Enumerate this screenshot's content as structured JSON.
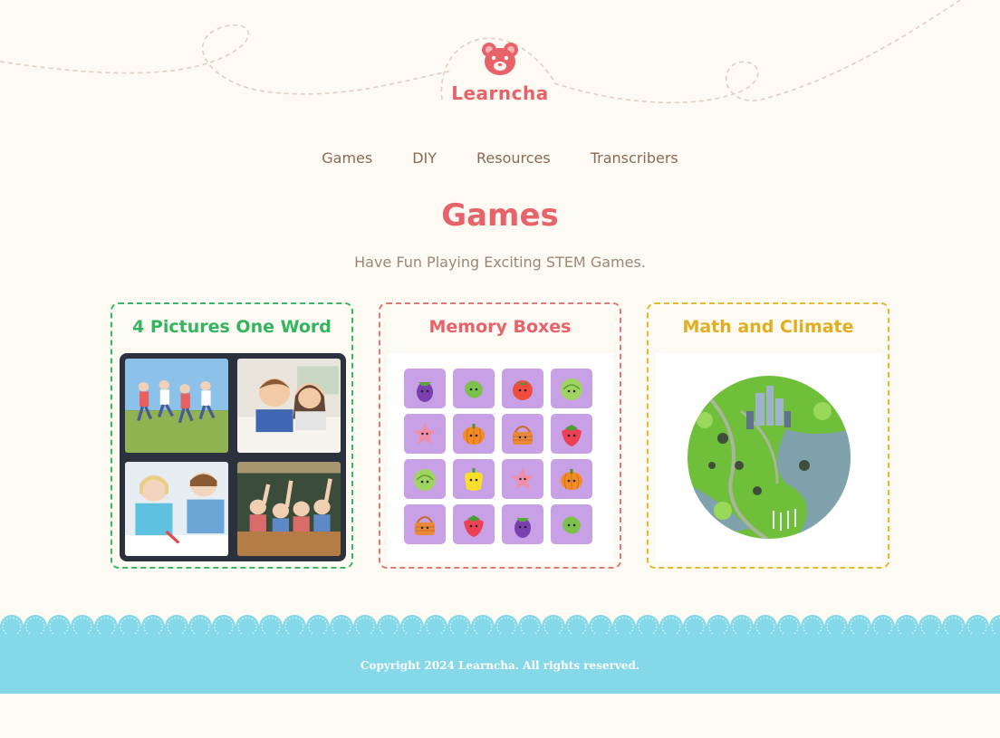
{
  "brand": {
    "name": "Learncha"
  },
  "nav": {
    "items": [
      {
        "label": "Games"
      },
      {
        "label": "DIY"
      },
      {
        "label": "Resources"
      },
      {
        "label": "Transcribers"
      }
    ]
  },
  "page": {
    "title": "Games",
    "subtitle": "Have Fun Playing Exciting STEM Games."
  },
  "cards": [
    {
      "title": "4 Pictures One Word",
      "accent": "#37b866"
    },
    {
      "title": "Memory Boxes",
      "accent": "#e37777"
    },
    {
      "title": "Math and Climate",
      "accent": "#e4ba2c"
    }
  ],
  "memory_tiles": [
    "eggplant",
    "cucumber",
    "tomato",
    "cabbage",
    "starfish",
    "pumpkin",
    "basket",
    "strawberry",
    "cabbage",
    "bell-pepper",
    "starfish",
    "pumpkin",
    "basket",
    "strawberry",
    "eggplant",
    "cucumber"
  ],
  "footer": {
    "copyright": "Copyright 2024 Learncha. All rights reserved."
  },
  "colors": {
    "background": "#fdfaf4",
    "brand": "#e8626a",
    "nav": "#8a6a56",
    "footer": "#85d8e7",
    "tile": "#c8a0e6"
  }
}
